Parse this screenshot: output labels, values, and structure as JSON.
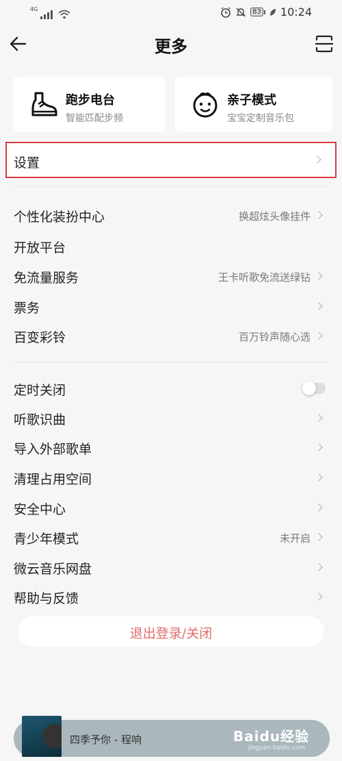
{
  "status_bar": {
    "network_type": "4G",
    "battery_level": "83",
    "time": "10:24",
    "icons": [
      "signal-icon",
      "wifi-icon",
      "alarm-icon",
      "mute-icon",
      "battery-icon",
      "leaf-icon"
    ]
  },
  "nav": {
    "title": "更多",
    "back_icon": "back-arrow-icon",
    "action_icon": "scan-icon"
  },
  "feature_cards": [
    {
      "title": "跑步电台",
      "subtitle": "智能匹配步频",
      "icon": "running-shoe-icon"
    },
    {
      "title": "亲子模式",
      "subtitle": "宝宝定制音乐包",
      "icon": "baby-face-icon"
    }
  ],
  "settings": {
    "label": "设置",
    "highlight_color": "#d83a44"
  },
  "group1": [
    {
      "label": "个性化装扮中心",
      "value": "换超炫头像挂件"
    },
    {
      "label": "开放平台",
      "value": ""
    },
    {
      "label": "免流量服务",
      "value": "王卡听歌免流送绿钻"
    },
    {
      "label": "票务",
      "value": ""
    },
    {
      "label": "百变彩铃",
      "value": "百万铃声随心选"
    }
  ],
  "group2": [
    {
      "label": "定时关闭",
      "value": "",
      "toggle": false
    },
    {
      "label": "听歌识曲",
      "value": ""
    },
    {
      "label": "导入外部歌单",
      "value": ""
    },
    {
      "label": "清理占用空间",
      "value": ""
    },
    {
      "label": "安全中心",
      "value": ""
    },
    {
      "label": "青少年模式",
      "value": "未开启"
    },
    {
      "label": "微云音乐网盘",
      "value": ""
    },
    {
      "label": "帮助与反馈",
      "value": ""
    }
  ],
  "logout": {
    "label": "退出登录/关闭",
    "color": "#e06a6a"
  },
  "player": {
    "track": "四季予你 - 程响"
  },
  "watermark": {
    "text": "Baidu经验",
    "sub": "jingyan.baidu.com"
  }
}
